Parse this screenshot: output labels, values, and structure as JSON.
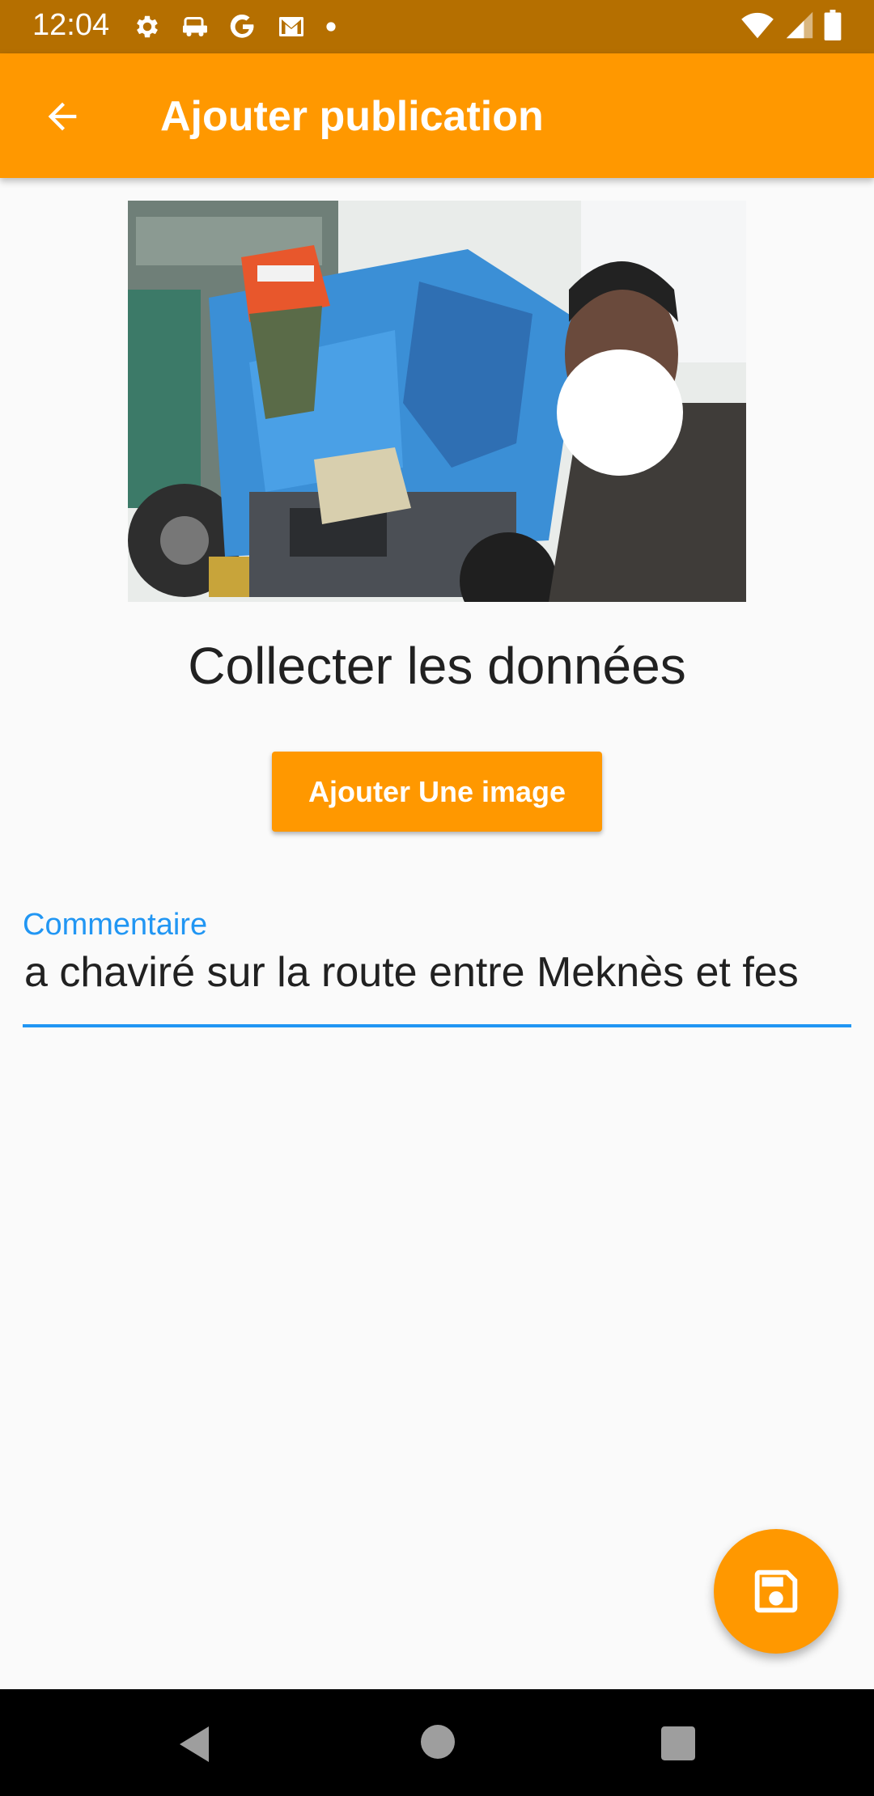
{
  "status_bar": {
    "time": "12:04",
    "left_icons": [
      "settings-icon",
      "car-icon",
      "google-icon",
      "gmail-icon",
      "dot-icon"
    ],
    "right_icons": [
      "wifi-icon",
      "signal-icon",
      "battery-icon"
    ]
  },
  "app_bar": {
    "title": "Ajouter publication",
    "back_icon": "arrow-back-icon",
    "color": "#ff9800"
  },
  "main": {
    "photo": {
      "subject": "accident-truck-photo"
    },
    "title": "Collecter les données",
    "add_image_button": "Ajouter Une image",
    "comment": {
      "label": "Commentaire",
      "value": "a chaviré sur la route entre Meknès et fes"
    }
  },
  "fab": {
    "icon": "save-icon",
    "color": "#ff9800"
  },
  "nav_bar": {
    "icons": [
      "nav-back-icon",
      "nav-home-icon",
      "nav-recents-icon"
    ]
  },
  "colors": {
    "accent": "#ff9800",
    "status_bar": "#b56f00",
    "field_focus": "#2196f3",
    "background": "#fafafa"
  }
}
